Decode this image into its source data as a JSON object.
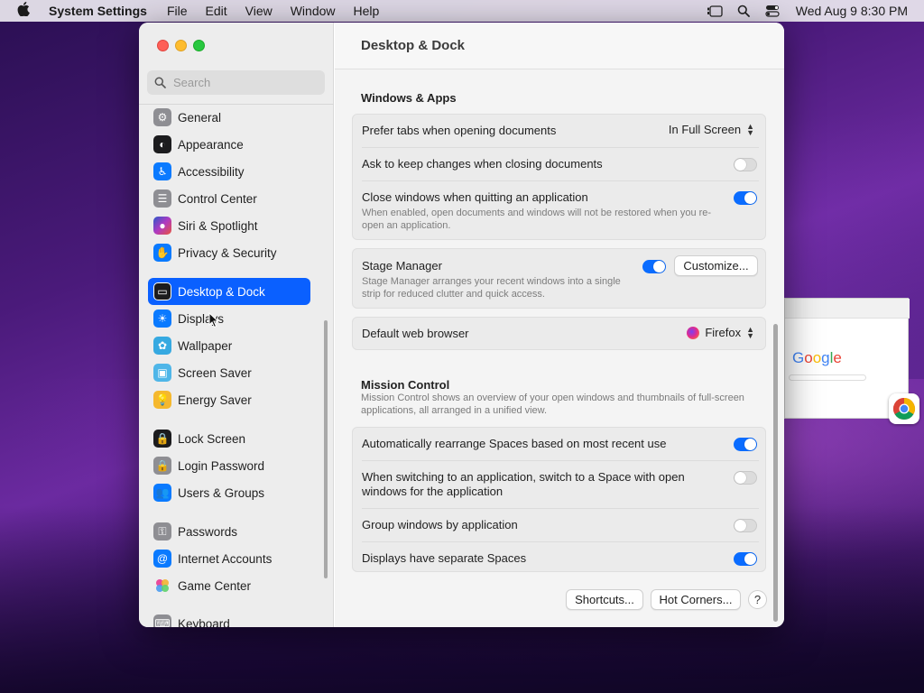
{
  "menubar": {
    "app_name": "System Settings",
    "menus": [
      "File",
      "Edit",
      "View",
      "Window",
      "Help"
    ],
    "clock": "Wed Aug 9  8:30 PM"
  },
  "sidebar": {
    "search_placeholder": "Search",
    "items": [
      {
        "label": "General",
        "icon": "gear-icon",
        "color": "#8e8e93"
      },
      {
        "label": "Appearance",
        "icon": "appearance-icon",
        "color": "#1c1c1e"
      },
      {
        "label": "Accessibility",
        "icon": "accessibility-icon",
        "color": "#0a7aff"
      },
      {
        "label": "Control Center",
        "icon": "control-center-icon",
        "color": "#8e8e93"
      },
      {
        "label": "Siri & Spotlight",
        "icon": "siri-icon",
        "color": "#6b3fa0"
      },
      {
        "label": "Privacy & Security",
        "icon": "hand-icon",
        "color": "#0a7aff"
      },
      {
        "label": "Desktop & Dock",
        "icon": "dock-icon",
        "color": "#1c1c1e"
      },
      {
        "label": "Displays",
        "icon": "sun-icon",
        "color": "#0a7aff"
      },
      {
        "label": "Wallpaper",
        "icon": "flower-icon",
        "color": "#36a9e1"
      },
      {
        "label": "Screen Saver",
        "icon": "screen-saver-icon",
        "color": "#4fb6e8"
      },
      {
        "label": "Energy Saver",
        "icon": "bulb-icon",
        "color": "#f5b82e"
      },
      {
        "label": "Lock Screen",
        "icon": "lock-icon",
        "color": "#1c1c1e"
      },
      {
        "label": "Login Password",
        "icon": "lock-icon",
        "color": "#8e8e93"
      },
      {
        "label": "Users & Groups",
        "icon": "users-icon",
        "color": "#0a7aff"
      },
      {
        "label": "Passwords",
        "icon": "key-icon",
        "color": "#8e8e93"
      },
      {
        "label": "Internet Accounts",
        "icon": "at-icon",
        "color": "#0a7aff"
      },
      {
        "label": "Game Center",
        "icon": "game-center-icon",
        "color": "#ffffff"
      },
      {
        "label": "Keyboard",
        "icon": "keyboard-icon",
        "color": "#8e8e93"
      }
    ]
  },
  "main": {
    "title": "Desktop & Dock",
    "windows_apps": {
      "heading": "Windows & Apps",
      "prefer_tabs": {
        "label": "Prefer tabs when opening documents",
        "value": "In Full Screen"
      },
      "ask_keep": {
        "label": "Ask to keep changes when closing documents",
        "on": false
      },
      "close_windows": {
        "label": "Close windows when quitting an application",
        "desc": "When enabled, open documents and windows will not be restored when you re-open an application.",
        "on": true
      }
    },
    "stage_manager": {
      "label": "Stage Manager",
      "desc": "Stage Manager arranges your recent windows into a single strip for reduced clutter and quick access.",
      "on": true,
      "customize_label": "Customize..."
    },
    "default_browser": {
      "label": "Default web browser",
      "value": "Firefox"
    },
    "mission_control": {
      "heading": "Mission Control",
      "desc": "Mission Control shows an overview of your open windows and thumbnails of full-screen applications, all arranged in a unified view.",
      "rows": [
        {
          "label": "Automatically rearrange Spaces based on most recent use",
          "on": true
        },
        {
          "label": "When switching to an application, switch to a Space with open windows for the application",
          "on": false
        },
        {
          "label": "Group windows by application",
          "on": false
        },
        {
          "label": "Displays have separate Spaces",
          "on": true
        }
      ]
    },
    "footer": {
      "shortcuts_label": "Shortcuts...",
      "hot_corners_label": "Hot Corners...",
      "help_label": "?"
    }
  },
  "preview": {
    "logo_text": "Google"
  }
}
